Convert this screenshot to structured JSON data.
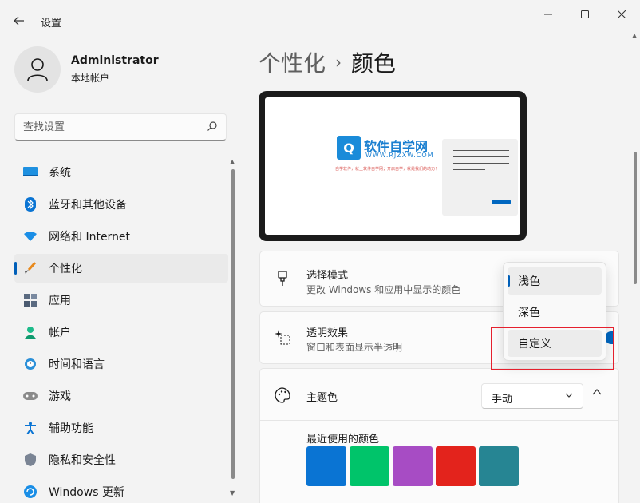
{
  "window": {
    "title": "设置"
  },
  "profile": {
    "name": "Administrator",
    "type": "本地帐户"
  },
  "search": {
    "placeholder": "查找设置"
  },
  "nav": {
    "items": [
      {
        "label": "系统",
        "icon": "system-icon"
      },
      {
        "label": "蓝牙和其他设备",
        "icon": "bluetooth-icon"
      },
      {
        "label": "网络和 Internet",
        "icon": "network-icon"
      },
      {
        "label": "个性化",
        "icon": "personalization-brush-icon",
        "active": true
      },
      {
        "label": "应用",
        "icon": "apps-icon"
      },
      {
        "label": "帐户",
        "icon": "account-icon"
      },
      {
        "label": "时间和语言",
        "icon": "time-language-icon"
      },
      {
        "label": "游戏",
        "icon": "gaming-icon"
      },
      {
        "label": "辅助功能",
        "icon": "accessibility-icon"
      },
      {
        "label": "隐私和安全性",
        "icon": "privacy-shield-icon"
      },
      {
        "label": "Windows 更新",
        "icon": "windows-update-icon"
      }
    ]
  },
  "breadcrumb": {
    "parent": "个性化",
    "separator": "›",
    "current": "颜色"
  },
  "preview": {
    "logo_text": "软件自学网",
    "logo_url": "WWW.RJZXW.COM",
    "slogan": "自学软件，就上软件自学网；开启自学，就是我们的动力！"
  },
  "settings": {
    "mode": {
      "title": "选择模式",
      "subtitle": "更改 Windows 和应用中显示的颜色"
    },
    "transparency": {
      "title": "透明效果",
      "subtitle": "窗口和表面显示半透明"
    },
    "accent": {
      "title": "主题色",
      "selected": "手动"
    },
    "recent": {
      "label": "最近使用的颜色",
      "colors": [
        "#0a74d3",
        "#00c46a",
        "#a74cc4",
        "#e3231c",
        "#268593"
      ]
    }
  },
  "mode_dropdown": {
    "options": [
      "浅色",
      "深色",
      "自定义"
    ],
    "selected": "浅色",
    "hovered": "自定义"
  },
  "colors": {
    "accent": "#005fb8",
    "highlight": "#e5202e"
  }
}
